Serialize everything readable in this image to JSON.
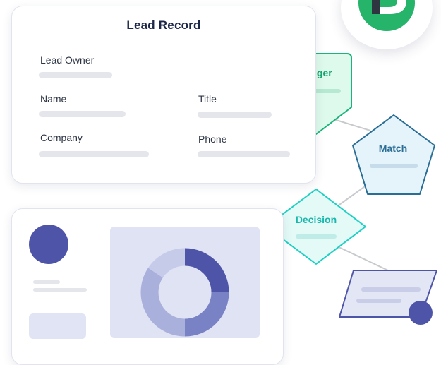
{
  "lead_record": {
    "title": "Lead Record",
    "fields": {
      "lead_owner": "Lead Owner",
      "name": "Name",
      "title": "Title",
      "company": "Company",
      "phone": "Phone"
    }
  },
  "workflow": {
    "trigger": "Trigger",
    "match": "Match",
    "decision": "Decision"
  },
  "colors": {
    "trigger_stroke": "#1bb57c",
    "trigger_fill": "#defaec",
    "match_stroke": "#2a6e96",
    "match_fill": "#e5f3fb",
    "decision_stroke": "#1fd0c4",
    "decision_fill": "#e3faf7",
    "accent_purple": "#4e55a9",
    "logo_green": "#25b46a"
  },
  "icons": {
    "logo": "brand-logo-icon",
    "chart": "donut-chart-icon"
  }
}
